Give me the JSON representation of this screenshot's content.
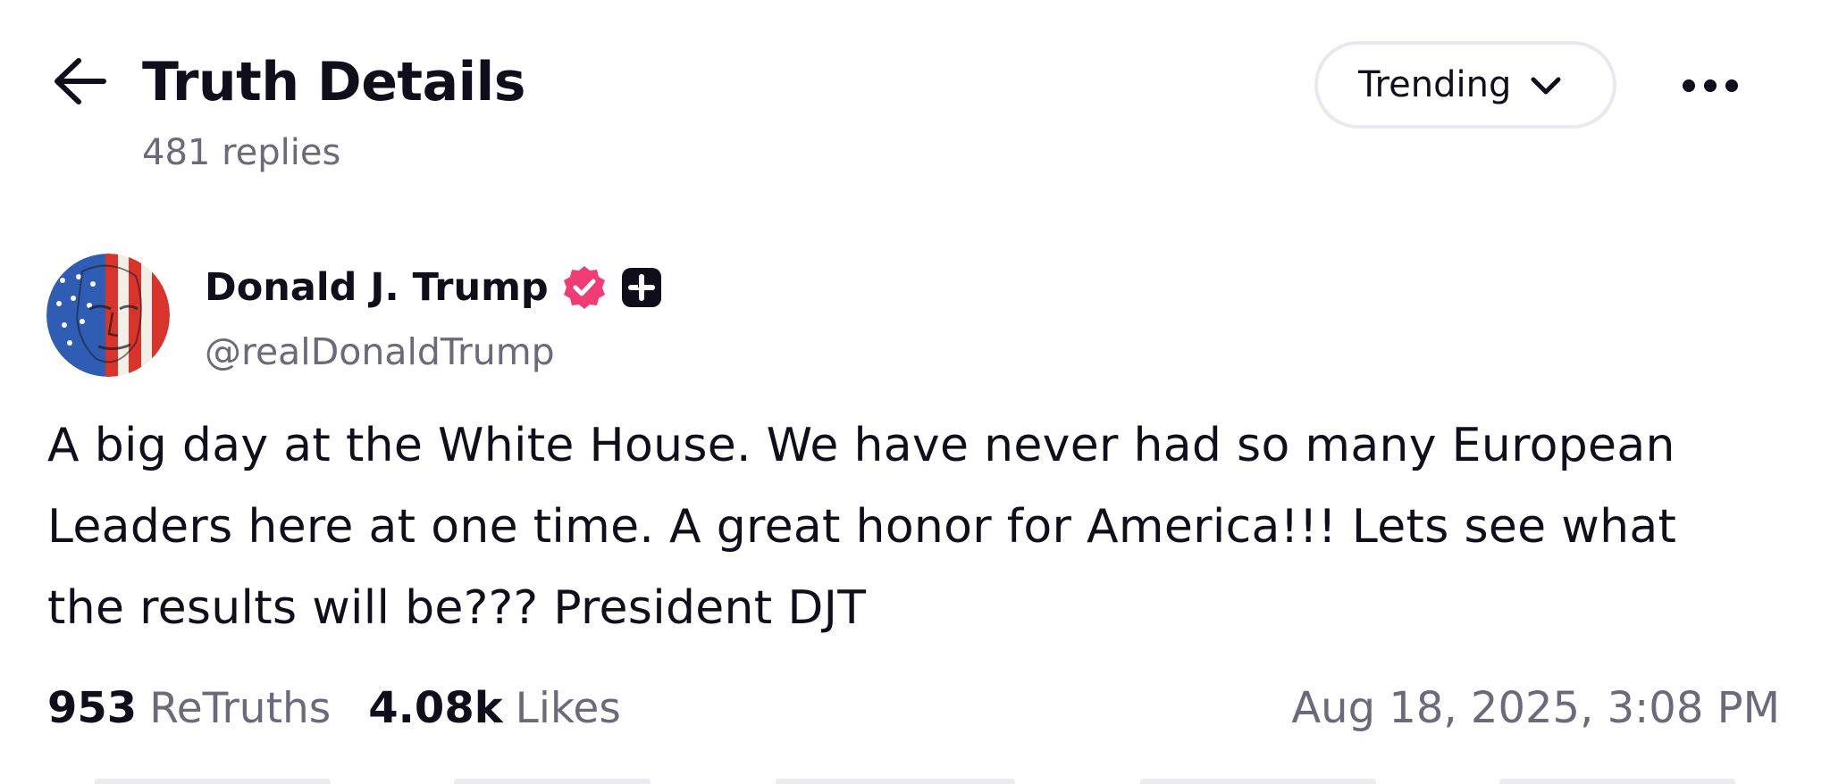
{
  "header": {
    "back_icon": "arrow-left-icon",
    "title": "Truth Details",
    "reply_count": "481 replies",
    "sort": {
      "selected": "Trending",
      "icon": "chevron-down-icon"
    },
    "more_icon": "ellipsis-icon"
  },
  "post": {
    "author": {
      "name": "Donald J. Trump",
      "handle": "@realDonaldTrump",
      "verified_icon": "verified-badge-icon",
      "plus_icon": "plus-badge-icon",
      "avatar": "avatar"
    },
    "text_lines": [
      "A big day at the White House. We have never had so many European",
      "Leaders here at one time. A great honor for America!!! Lets see what",
      "the results will be??? President DJT"
    ],
    "stats": {
      "retruths_count": "953",
      "retruths_label": "ReTruths",
      "likes_count": "4.08k",
      "likes_label": "Likes"
    },
    "timestamp": "Aug 18, 2025, 3:08 PM"
  },
  "colors": {
    "text_primary": "#0f0e1a",
    "text_secondary": "#6b6a7a",
    "verified_badge": "#f03b74",
    "border": "#e9e8ee"
  }
}
